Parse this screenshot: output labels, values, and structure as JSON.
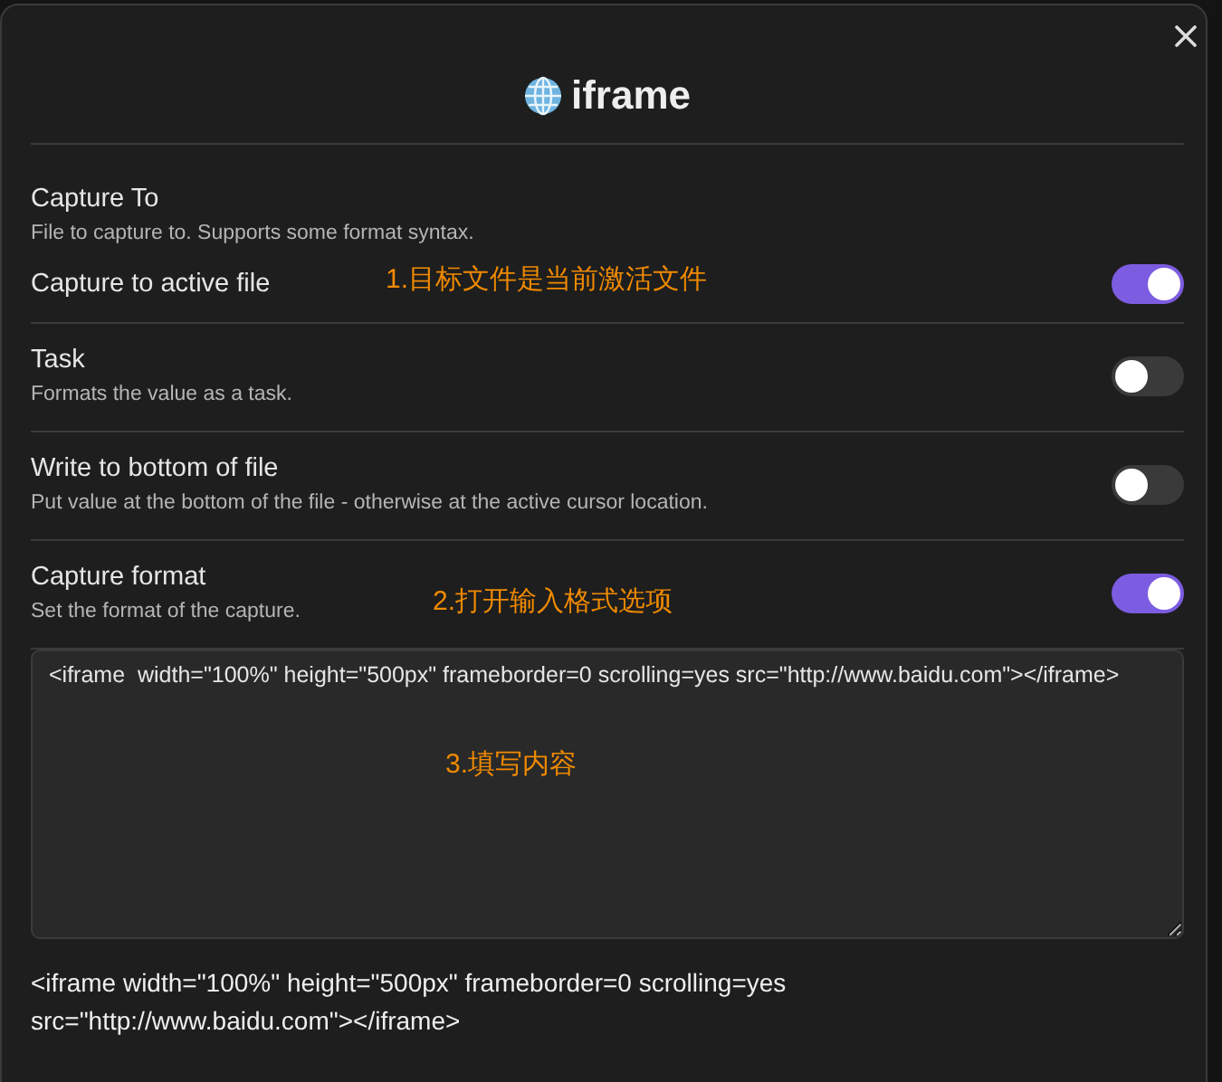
{
  "dialog": {
    "title": "iframe"
  },
  "settings": [
    {
      "kind": "group",
      "name": "Capture To",
      "description": "File to capture to. Supports some format syntax.",
      "option": {
        "label": "Capture to active file",
        "on": true,
        "annotation": "1.目标文件是当前激活文件"
      }
    },
    {
      "kind": "toggle",
      "name": "Task",
      "description": "Formats the value as a task.",
      "on": false
    },
    {
      "kind": "toggle",
      "name": "Write to bottom of file",
      "description": "Put value at the bottom of the file - otherwise at the active cursor location.",
      "on": false
    },
    {
      "kind": "toggle",
      "name": "Capture format",
      "description": "Set the format of the capture.",
      "on": true,
      "annotation": "2.打开输入格式选项"
    }
  ],
  "format_field": {
    "value": "<iframe  width=\"100%\" height=\"500px\" frameborder=0 scrolling=yes src=\"http://www.baidu.com\"></iframe>",
    "annotation": "3.填写内容"
  },
  "preview": "<iframe width=\"100%\" height=\"500px\" frameborder=0 scrolling=yes src=\"http://www.baidu.com\"></iframe>"
}
